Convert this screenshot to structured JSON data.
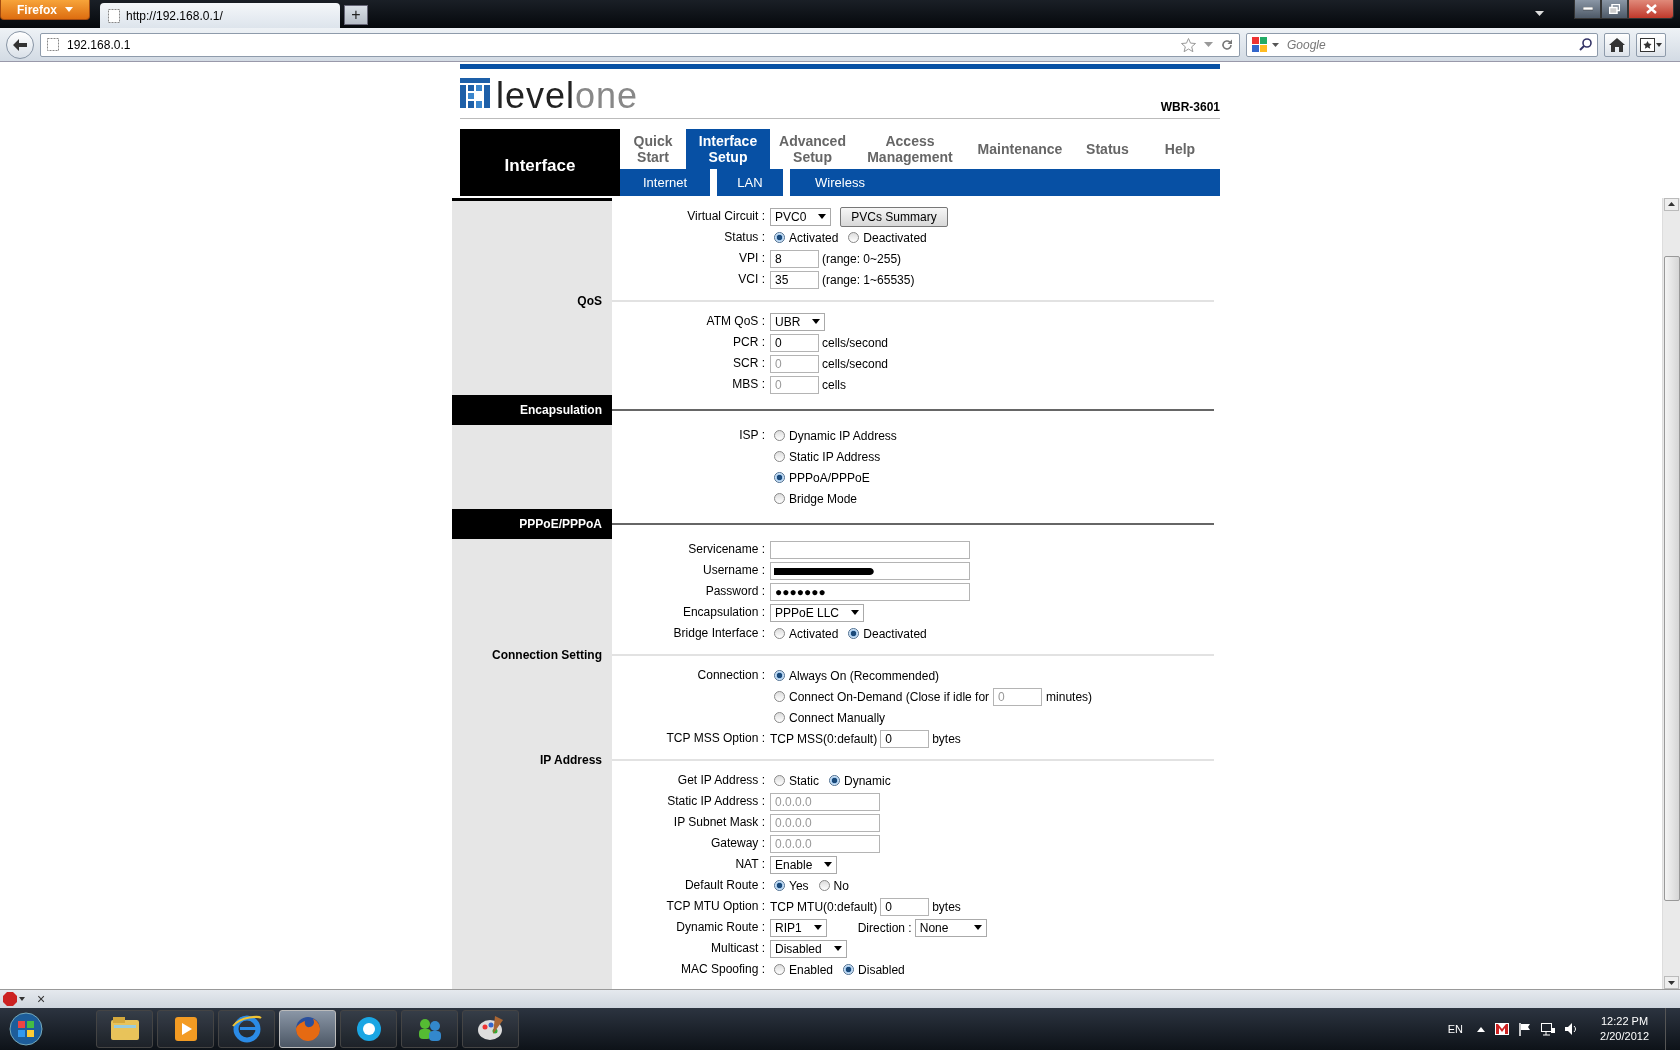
{
  "browser": {
    "menu_button": "Firefox",
    "tab_title": "http://192.168.0.1/",
    "new_tab": "+",
    "url": "192.168.0.1",
    "search_placeholder": "Google"
  },
  "router": {
    "logo_dark": "level",
    "logo_light": "one",
    "model": "WBR-3601",
    "section": "Interface",
    "nav": [
      {
        "label": "Quick Start",
        "selected": false
      },
      {
        "label": "Interface Setup",
        "selected": true
      },
      {
        "label": "Advanced Setup",
        "selected": false
      },
      {
        "label": "Access Management",
        "selected": false
      },
      {
        "label": "Maintenance",
        "selected": false
      },
      {
        "label": "Status",
        "selected": false
      },
      {
        "label": "Help",
        "selected": false
      }
    ],
    "subnav": [
      "Internet",
      "LAN",
      "Wireless"
    ]
  },
  "form": [
    {
      "kind": "plain",
      "rows": [
        {
          "kind": "select",
          "label": "Virtual Circuit :",
          "value": "PVC0",
          "button": "PVCs Summary"
        },
        {
          "kind": "radio",
          "label": "Status :",
          "options": [
            {
              "label": "Activated",
              "selected": true
            },
            {
              "label": "Deactivated",
              "selected": false
            }
          ]
        },
        {
          "kind": "short-input",
          "label": "VPI :",
          "value": "8",
          "disabled": false,
          "suffix": "(range: 0~255)"
        },
        {
          "kind": "short-input",
          "label": "VCI :",
          "value": "35",
          "disabled": false,
          "suffix": "(range: 1~65535)"
        }
      ]
    },
    {
      "kind": "line",
      "title": "QoS",
      "rows": [
        {
          "kind": "select",
          "label": "ATM QoS :",
          "value": "UBR"
        },
        {
          "kind": "short-input",
          "label": "PCR :",
          "value": "0",
          "disabled": false,
          "suffix": "cells/second"
        },
        {
          "kind": "short-input",
          "label": "SCR :",
          "value": "0",
          "disabled": true,
          "suffix": "cells/second"
        },
        {
          "kind": "short-input",
          "label": "MBS :",
          "value": "0",
          "disabled": true,
          "suffix": "cells"
        }
      ]
    },
    {
      "kind": "bar",
      "title": "Encapsulation",
      "rows": [
        {
          "kind": "radio-list",
          "label": "ISP :",
          "options": [
            {
              "label": "Dynamic IP Address",
              "selected": false
            },
            {
              "label": "Static IP Address",
              "selected": false
            },
            {
              "label": "PPPoA/PPPoE",
              "selected": true
            },
            {
              "label": "Bridge Mode",
              "selected": false
            }
          ]
        }
      ]
    },
    {
      "kind": "bar",
      "title": "PPPoE/PPPoA",
      "rows": [
        {
          "kind": "long-input",
          "label": "Servicename :"
        },
        {
          "kind": "redacted-input",
          "label": "Username :"
        },
        {
          "kind": "long-input",
          "label": "Password :",
          "value": "●●●●●●●",
          "disabled": false
        },
        {
          "kind": "select",
          "label": "Encapsulation :",
          "value": "PPPoE LLC"
        },
        {
          "kind": "radio",
          "label": "Bridge Interface :",
          "options": [
            {
              "label": "Activated",
              "selected": false
            },
            {
              "label": "Deactivated",
              "selected": true
            }
          ]
        }
      ]
    },
    {
      "kind": "line",
      "title": "Connection Setting",
      "rows": [
        {
          "kind": "radio-list",
          "label": "Connection :",
          "options": [
            {
              "label": "Always On (Recommended)",
              "selected": true
            },
            {
              "label": "Connect On-Demand (Close if idle for",
              "selected": false,
              "input": {
                "value": "0",
                "disabled": true
              },
              "suffix": "minutes)"
            },
            {
              "label": "Connect Manually",
              "selected": false
            }
          ]
        },
        {
          "kind": "prefixed-input",
          "label": "TCP MSS Option :",
          "prefix": "TCP MSS(0:default)",
          "value": "0",
          "disabled": false,
          "suffix": "bytes"
        }
      ]
    },
    {
      "kind": "line",
      "title": "IP Address",
      "rows": [
        {
          "kind": "radio",
          "label": "Get IP Address :",
          "options": [
            {
              "label": "Static",
              "selected": false
            },
            {
              "label": "Dynamic",
              "selected": true
            }
          ]
        },
        {
          "kind": "ip-input",
          "label": "Static IP Address :",
          "value": "0.0.0.0",
          "disabled": true
        },
        {
          "kind": "ip-input",
          "label": "IP Subnet Mask :",
          "value": "0.0.0.0",
          "disabled": true
        },
        {
          "kind": "ip-input",
          "label": "Gateway :",
          "value": "0.0.0.0",
          "disabled": true
        },
        {
          "kind": "select",
          "label": "NAT :",
          "value": "Enable"
        },
        {
          "kind": "radio",
          "label": "Default Route :",
          "options": [
            {
              "label": "Yes",
              "selected": true
            },
            {
              "label": "No",
              "selected": false
            }
          ]
        },
        {
          "kind": "prefixed-input",
          "label": "TCP MTU Option :",
          "prefix": "TCP MTU(0:default)",
          "value": "0",
          "disabled": false,
          "suffix": "bytes"
        },
        {
          "kind": "select",
          "label": "Dynamic Route :",
          "value": "RIP1",
          "extra": {
            "label": "Direction :",
            "value": "None"
          }
        },
        {
          "kind": "select",
          "label": "Multicast :",
          "value": "Disabled"
        },
        {
          "kind": "radio",
          "label": "MAC Spoofing :",
          "options": [
            {
              "label": "Enabled",
              "selected": false
            },
            {
              "label": "Disabled",
              "selected": true
            }
          ]
        }
      ]
    }
  ],
  "addon_bar": {
    "close": "×"
  },
  "taskbar": {
    "apps": [
      {
        "kind": "folder",
        "selected": false
      },
      {
        "kind": "media",
        "selected": false
      },
      {
        "kind": "ie",
        "selected": false
      },
      {
        "kind": "firefox",
        "selected": true
      },
      {
        "kind": "skype",
        "selected": false
      },
      {
        "kind": "messenger",
        "selected": false
      },
      {
        "kind": "paint",
        "selected": false
      }
    ],
    "language": "EN",
    "time": "12:22 PM",
    "date": "2/20/2012"
  }
}
